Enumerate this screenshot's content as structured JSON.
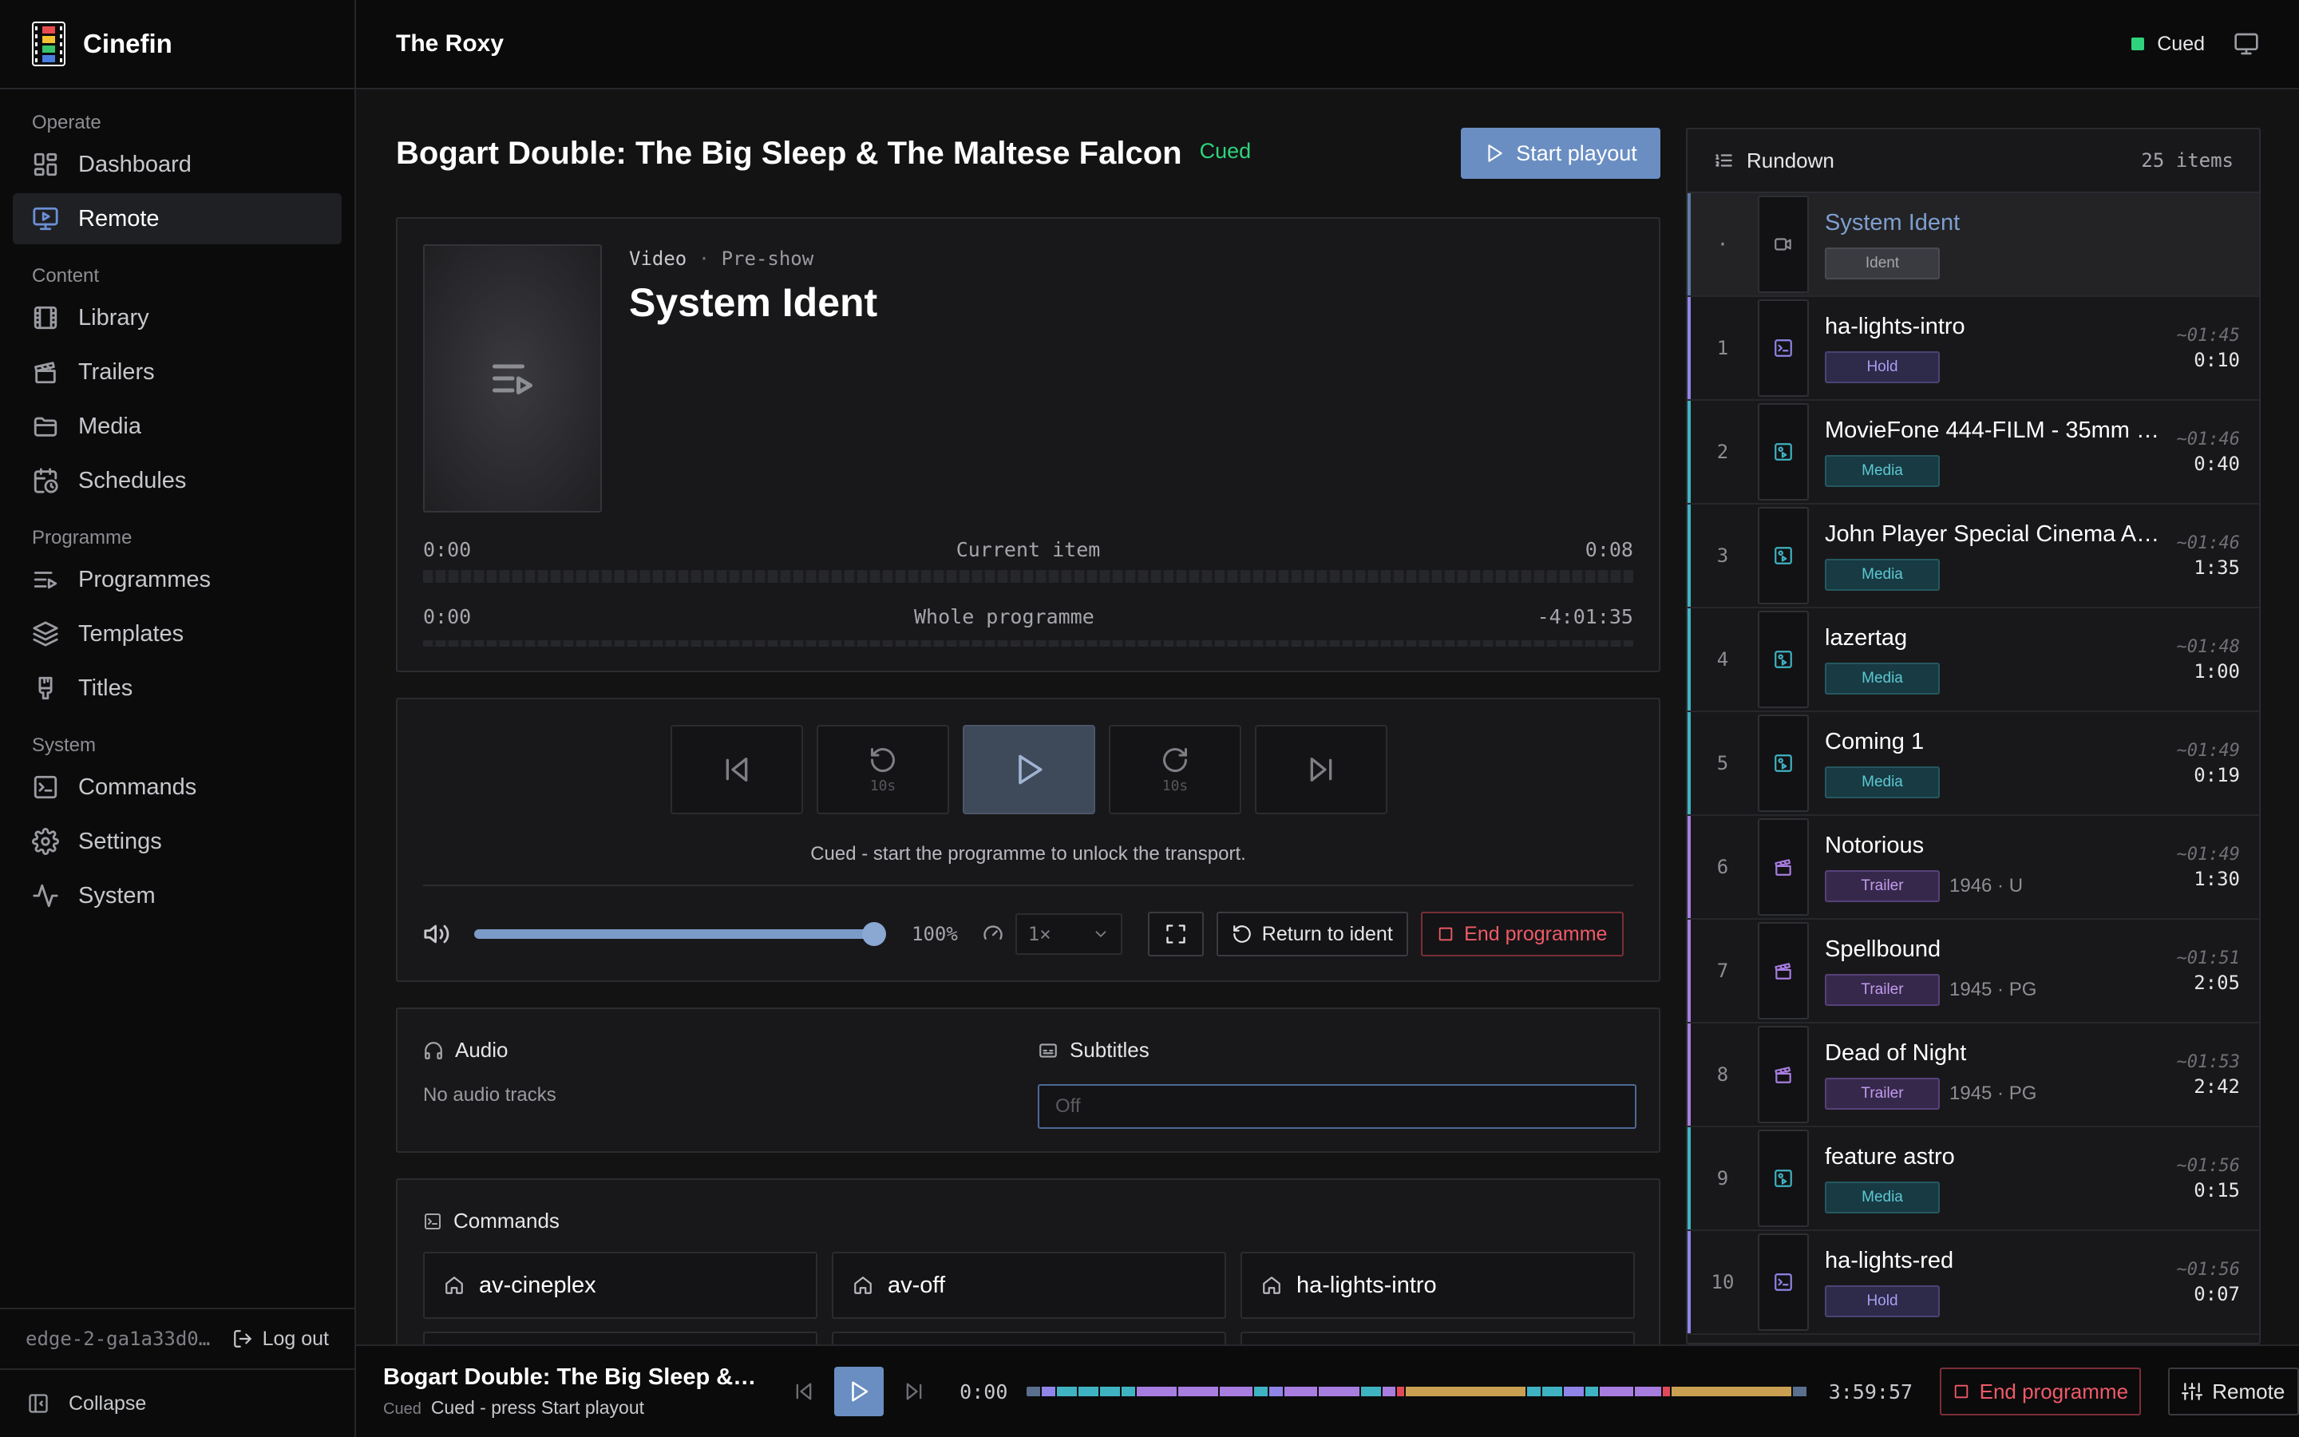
{
  "app": {
    "name": "Cinefin"
  },
  "sidebar": {
    "sections": [
      {
        "label": "Operate",
        "items": [
          {
            "label": "Dashboard",
            "icon": "dashboard-icon"
          },
          {
            "label": "Remote",
            "icon": "remote-icon",
            "active": true
          }
        ]
      },
      {
        "label": "Content",
        "items": [
          {
            "label": "Library",
            "icon": "film-icon"
          },
          {
            "label": "Trailers",
            "icon": "clapper-icon"
          },
          {
            "label": "Media",
            "icon": "folder-icon"
          },
          {
            "label": "Schedules",
            "icon": "calendar-clock-icon"
          }
        ]
      },
      {
        "label": "Programme",
        "items": [
          {
            "label": "Programmes",
            "icon": "playlist-icon"
          },
          {
            "label": "Templates",
            "icon": "layers-icon"
          },
          {
            "label": "Titles",
            "icon": "brush-icon"
          }
        ]
      },
      {
        "label": "System",
        "items": [
          {
            "label": "Commands",
            "icon": "terminal-icon"
          },
          {
            "label": "Settings",
            "icon": "gear-icon"
          },
          {
            "label": "System",
            "icon": "activity-icon"
          }
        ]
      }
    ],
    "node_id": "edge-2-ga1a33d0…",
    "logout_label": "Log out",
    "collapse_label": "Collapse"
  },
  "topbar": {
    "venue": "The Roxy",
    "status": "Cued"
  },
  "programme": {
    "title": "Bogart Double: The Big Sleep & The Maltese Falcon",
    "status": "Cued",
    "start_label": "Start playout"
  },
  "now": {
    "kind": "Video",
    "section": "Pre-show",
    "title": "System Ident",
    "current": {
      "start": "0:00",
      "label": "Current item",
      "end": "0:08"
    },
    "whole": {
      "start": "0:00",
      "label": "Whole programme",
      "end": "-4:01:35"
    }
  },
  "transport": {
    "skip_label": "10s",
    "message": "Cued - start the programme to unlock the transport.",
    "volume": "100%",
    "volume_level": 1.0,
    "speed": "1×",
    "return_label": "Return to ident",
    "end_label": "End programme"
  },
  "av": {
    "audio_label": "Audio",
    "audio_empty": "No audio tracks",
    "subtitles_label": "Subtitles",
    "subtitles_value": "Off"
  },
  "commands": {
    "label": "Commands",
    "items": [
      "av-cineplex",
      "av-off",
      "ha-lights-intro"
    ]
  },
  "rundown": {
    "label": "Rundown",
    "count": "25 items",
    "items": [
      {
        "num": "·",
        "name": "System Ident",
        "tag": "Ident",
        "kind": "ident",
        "eta": "",
        "dur": "",
        "extra": "",
        "current": true
      },
      {
        "num": "1",
        "name": "ha-lights-intro",
        "tag": "Hold",
        "kind": "hold",
        "eta": "~01:45",
        "dur": "0:10",
        "extra": ""
      },
      {
        "num": "2",
        "name": "MovieFone 444-FILM - 35mm - …",
        "tag": "Media",
        "kind": "media",
        "eta": "~01:46",
        "dur": "0:40",
        "extra": ""
      },
      {
        "num": "3",
        "name": "John Player Special Cinema Ad…",
        "tag": "Media",
        "kind": "media",
        "eta": "~01:46",
        "dur": "1:35",
        "extra": ""
      },
      {
        "num": "4",
        "name": "lazertag",
        "tag": "Media",
        "kind": "media",
        "eta": "~01:48",
        "dur": "1:00",
        "extra": ""
      },
      {
        "num": "5",
        "name": "Coming 1",
        "tag": "Media",
        "kind": "media",
        "eta": "~01:49",
        "dur": "0:19",
        "extra": ""
      },
      {
        "num": "6",
        "name": "Notorious",
        "tag": "Trailer",
        "kind": "trailer",
        "eta": "~01:49",
        "dur": "1:30",
        "extra": "1946 · U"
      },
      {
        "num": "7",
        "name": "Spellbound",
        "tag": "Trailer",
        "kind": "trailer",
        "eta": "~01:51",
        "dur": "2:05",
        "extra": "1945 · PG"
      },
      {
        "num": "8",
        "name": "Dead of Night",
        "tag": "Trailer",
        "kind": "trailer",
        "eta": "~01:53",
        "dur": "2:42",
        "extra": "1945 · PG"
      },
      {
        "num": "9",
        "name": "feature astro",
        "tag": "Media",
        "kind": "media",
        "eta": "~01:56",
        "dur": "0:15",
        "extra": ""
      },
      {
        "num": "10",
        "name": "ha-lights-red",
        "tag": "Hold",
        "kind": "hold",
        "eta": "~01:56",
        "dur": "0:07",
        "extra": ""
      }
    ]
  },
  "bottombar": {
    "title": "Bogart Double: The Big Sleep & T…",
    "state": "Cued",
    "hint": "Cued - press Start playout",
    "time": "0:00",
    "remaining": "3:59:57",
    "end_label": "End programme",
    "remote_label": "Remote"
  },
  "colors": {
    "accent": "#6a8ec2",
    "cued": "#2fd37b",
    "danger": "#ef5a67",
    "hold": "#8f84e8",
    "media": "#3fb3c2",
    "trailer": "#a77de0"
  }
}
